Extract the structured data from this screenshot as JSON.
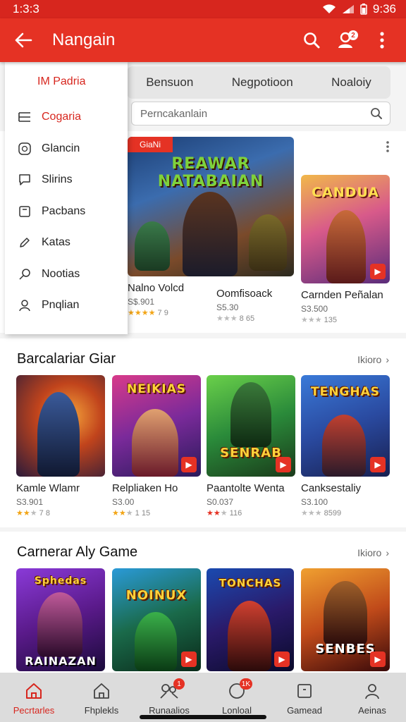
{
  "status_bar": {
    "time_left": "1:3:3",
    "time_right": "9:36"
  },
  "app_bar": {
    "title": "Nangain",
    "notification_count": "2"
  },
  "tabs": [
    "Bensuon",
    "Negpotioon",
    "Noaloiy"
  ],
  "search": {
    "placeholder": "Perncakanlain"
  },
  "drawer": {
    "header": "IM Padria",
    "items": [
      {
        "label": "Cogaria",
        "icon": "list-icon",
        "active": true
      },
      {
        "label": "Glancin",
        "icon": "clock-icon",
        "active": false
      },
      {
        "label": "Slirins",
        "icon": "chat-icon",
        "active": false
      },
      {
        "label": "Pacbans",
        "icon": "bag-icon",
        "active": false
      },
      {
        "label": "Katas",
        "icon": "pencil-icon",
        "active": false
      },
      {
        "label": "Nootias",
        "icon": "pin-icon",
        "active": false
      },
      {
        "label": "Pnqlian",
        "icon": "user-icon",
        "active": false
      }
    ]
  },
  "featured": {
    "hero": {
      "art_title": "REAWAR NATABAIAN",
      "tag": "GiaNi",
      "stars": "★★★★",
      "rating_text": "7 9",
      "name": "Nalno Volcd",
      "price": "S$.901"
    },
    "games": [
      {
        "name": "Oomfisoack",
        "price": "S5.30",
        "stars_on": "",
        "stars_off": "★★★",
        "rating_text": "8 65"
      },
      {
        "name": "Carnden Peñalan",
        "price": "S3.500",
        "art_title": "CANDUA",
        "stars_on": "",
        "stars_off": "★★★",
        "rating_text": "135"
      }
    ]
  },
  "sections": [
    {
      "title": "Barcalariar Giar",
      "more": "Ikioro",
      "games": [
        {
          "name": "Kamle Wlamr",
          "price": "S3.901",
          "art_title": "",
          "stars_on": "★★",
          "stars_off": "★",
          "rating_text": "7 8"
        },
        {
          "name": "Relpliaken Ho",
          "price": "S3.00",
          "art_title": "NEIKIAS",
          "stars_on": "★★",
          "stars_off": "★",
          "rating_text": "1 15"
        },
        {
          "name": "Paantolte Wenta",
          "price": "S0.037",
          "art_title": "SENRAB",
          "stars_on": "★★",
          "stars_off": "★",
          "rating_text": "116"
        },
        {
          "name": "Canksestaliy",
          "price": "S3.100",
          "art_title": "TENGHAS",
          "stars_on": "",
          "stars_off": "★★★",
          "rating_text": "8599"
        }
      ]
    },
    {
      "title": "Carnerar Aly Game",
      "more": "Ikioro",
      "games": [
        {
          "name": "",
          "price": "",
          "art_title": "RAINAZAN",
          "stars_on": "",
          "stars_off": "",
          "rating_text": ""
        },
        {
          "name": "",
          "price": "",
          "art_title": "NOINUX",
          "stars_on": "",
          "stars_off": "",
          "rating_text": ""
        },
        {
          "name": "",
          "price": "",
          "art_title": "TONCHAS",
          "stars_on": "",
          "stars_off": "",
          "rating_text": ""
        },
        {
          "name": "",
          "price": "",
          "art_title": "SENBES",
          "stars_on": "",
          "stars_off": "",
          "rating_text": ""
        }
      ]
    }
  ],
  "section2_top_art": [
    "Sphedas",
    "",
    "",
    ""
  ],
  "bottom_nav": [
    {
      "label": "Pecrtarles",
      "icon": "home-icon",
      "badge": "",
      "active": true
    },
    {
      "label": "Fhplekls",
      "icon": "house-outline-icon",
      "badge": "",
      "active": false
    },
    {
      "label": "Runaalios",
      "icon": "people-icon",
      "badge": "1",
      "active": false
    },
    {
      "label": "Lonloal",
      "icon": "chat-bubble-icon",
      "badge": "1K",
      "active": false
    },
    {
      "label": "Gamead",
      "icon": "box-icon",
      "badge": "",
      "active": false
    },
    {
      "label": "Aeinas",
      "icon": "user-icon",
      "badge": "",
      "active": false
    }
  ],
  "colors": {
    "brand": "#e53224",
    "star": "#f2a516"
  }
}
